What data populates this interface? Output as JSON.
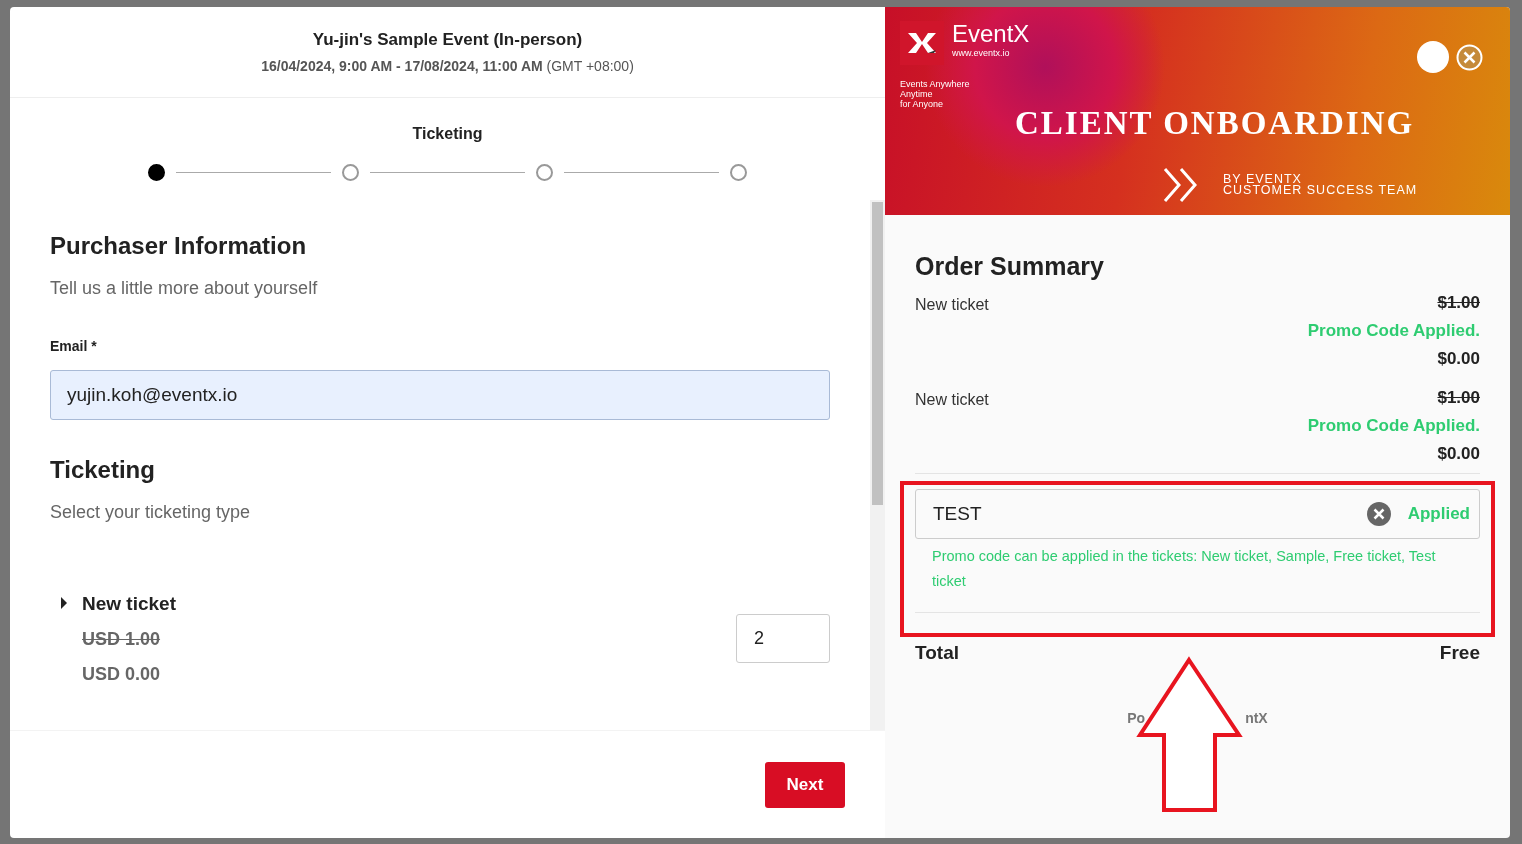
{
  "event": {
    "title": "Yu-jin's Sample Event (In-person)",
    "dates": "16/04/2024, 9:00 AM - 17/08/2024, 11:00 AM",
    "timezone": "(GMT +08:00)"
  },
  "stepper": {
    "title": "Ticketing",
    "steps": [
      {
        "selected": true
      },
      {
        "selected": false
      },
      {
        "selected": false
      },
      {
        "selected": false
      }
    ]
  },
  "purchaser": {
    "heading": "Purchaser Information",
    "subtitle": "Tell us a little more about yourself",
    "email_label": "Email *",
    "email_value": "yujin.koh@eventx.io"
  },
  "ticketing": {
    "heading": "Ticketing",
    "subtitle": "Select your ticketing type",
    "tickets": [
      {
        "name": "New ticket",
        "original_price": "USD 1.00",
        "price": "USD 0.00",
        "quantity": "2",
        "expanded": false
      }
    ]
  },
  "next_button": "Next",
  "banner": {
    "brand": "EventX",
    "url": "www.eventx.io",
    "tagline": [
      "Events Anywhere",
      "Anytime",
      "for Anyone"
    ],
    "title": "CLIENT ONBOARDING",
    "byline": [
      "BY EVENTX",
      "CUSTOMER SUCCESS TEAM"
    ]
  },
  "order_summary": {
    "heading": "Order Summary",
    "items": [
      {
        "name": "New ticket",
        "original_price": "$1.00",
        "promo_note": "Promo Code Applied.",
        "price": "$0.00"
      },
      {
        "name": "New ticket",
        "original_price": "$1.00",
        "promo_note": "Promo Code Applied.",
        "price": "$0.00"
      }
    ],
    "promo": {
      "value": "TEST",
      "status": "Applied",
      "message": "Promo code can be applied in the tickets: New ticket, Sample, Free ticket, Test ticket"
    },
    "total_label": "Total",
    "total_value": "Free",
    "footer_fragments": [
      "Po",
      "ntX"
    ]
  }
}
